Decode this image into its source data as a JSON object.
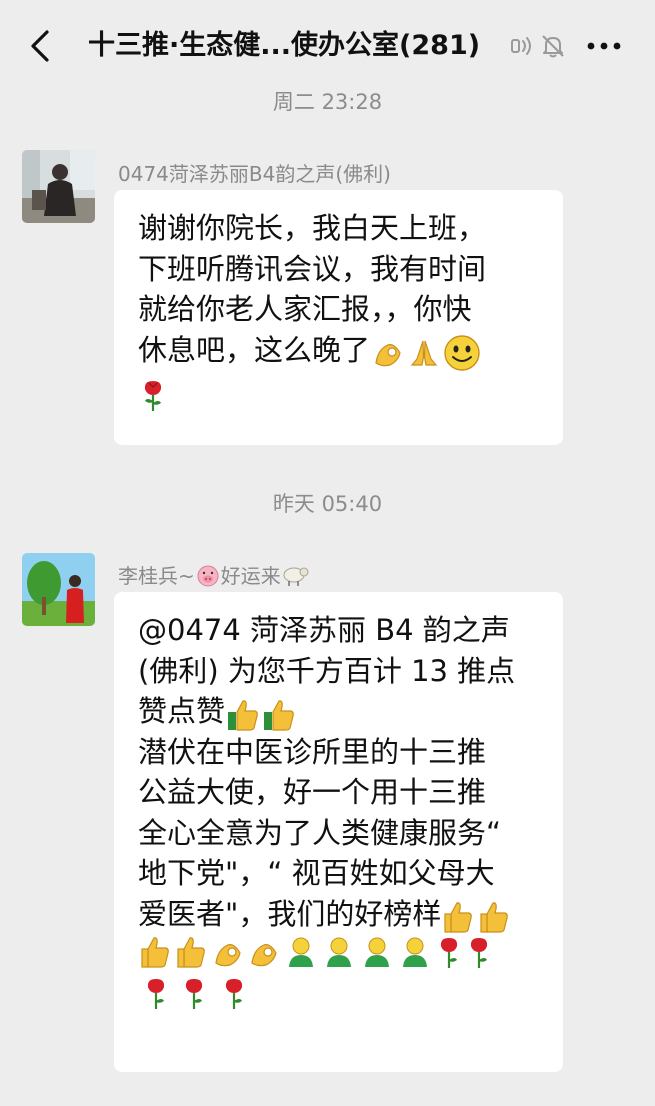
{
  "header": {
    "title": "十三推·生态健...使办公室(281)",
    "back_icon": "chevron-left-icon",
    "voice_icon": "voice-mode-icon",
    "mute_icon": "bell-muted-icon",
    "more_icon": "more-dots-icon"
  },
  "messages": [
    {
      "time": "周二 23:28",
      "sender": "0474菏泽苏丽B4韵之声(佛利)",
      "text": "谢谢你院长，我白天上班，\n下班听腾讯会议，我有时间\n就给你老人家汇报，，你快\n休息吧，这么晚了",
      "emojis": [
        "ok-hand-icon",
        "praying-hands-icon",
        "smiley-face-icon",
        "rose-icon"
      ]
    },
    {
      "time": "昨天 05:40",
      "sender_prefix": "李桂兵~",
      "sender_suffix": "好运来",
      "sender_emojis": [
        "pig-face-icon",
        "sheep-icon"
      ],
      "text_lines": [
        "@0474 菏泽苏丽 B4 韵之声",
        "(佛利) 为您千方百计 13 推点",
        "赞点赞",
        "潜伏在中医诊所里的十三推",
        "公益大使，好一个用十三推",
        "全心全意为了人类健康服务“",
        "地下党\"，“ 视百姓如父母大",
        "爱医者\"，我们的好榜样"
      ]
    }
  ],
  "colors": {
    "background": "#ededed",
    "bubble": "#ffffff",
    "timestamp": "#8c8c8c",
    "sender": "#8a8a8a"
  }
}
